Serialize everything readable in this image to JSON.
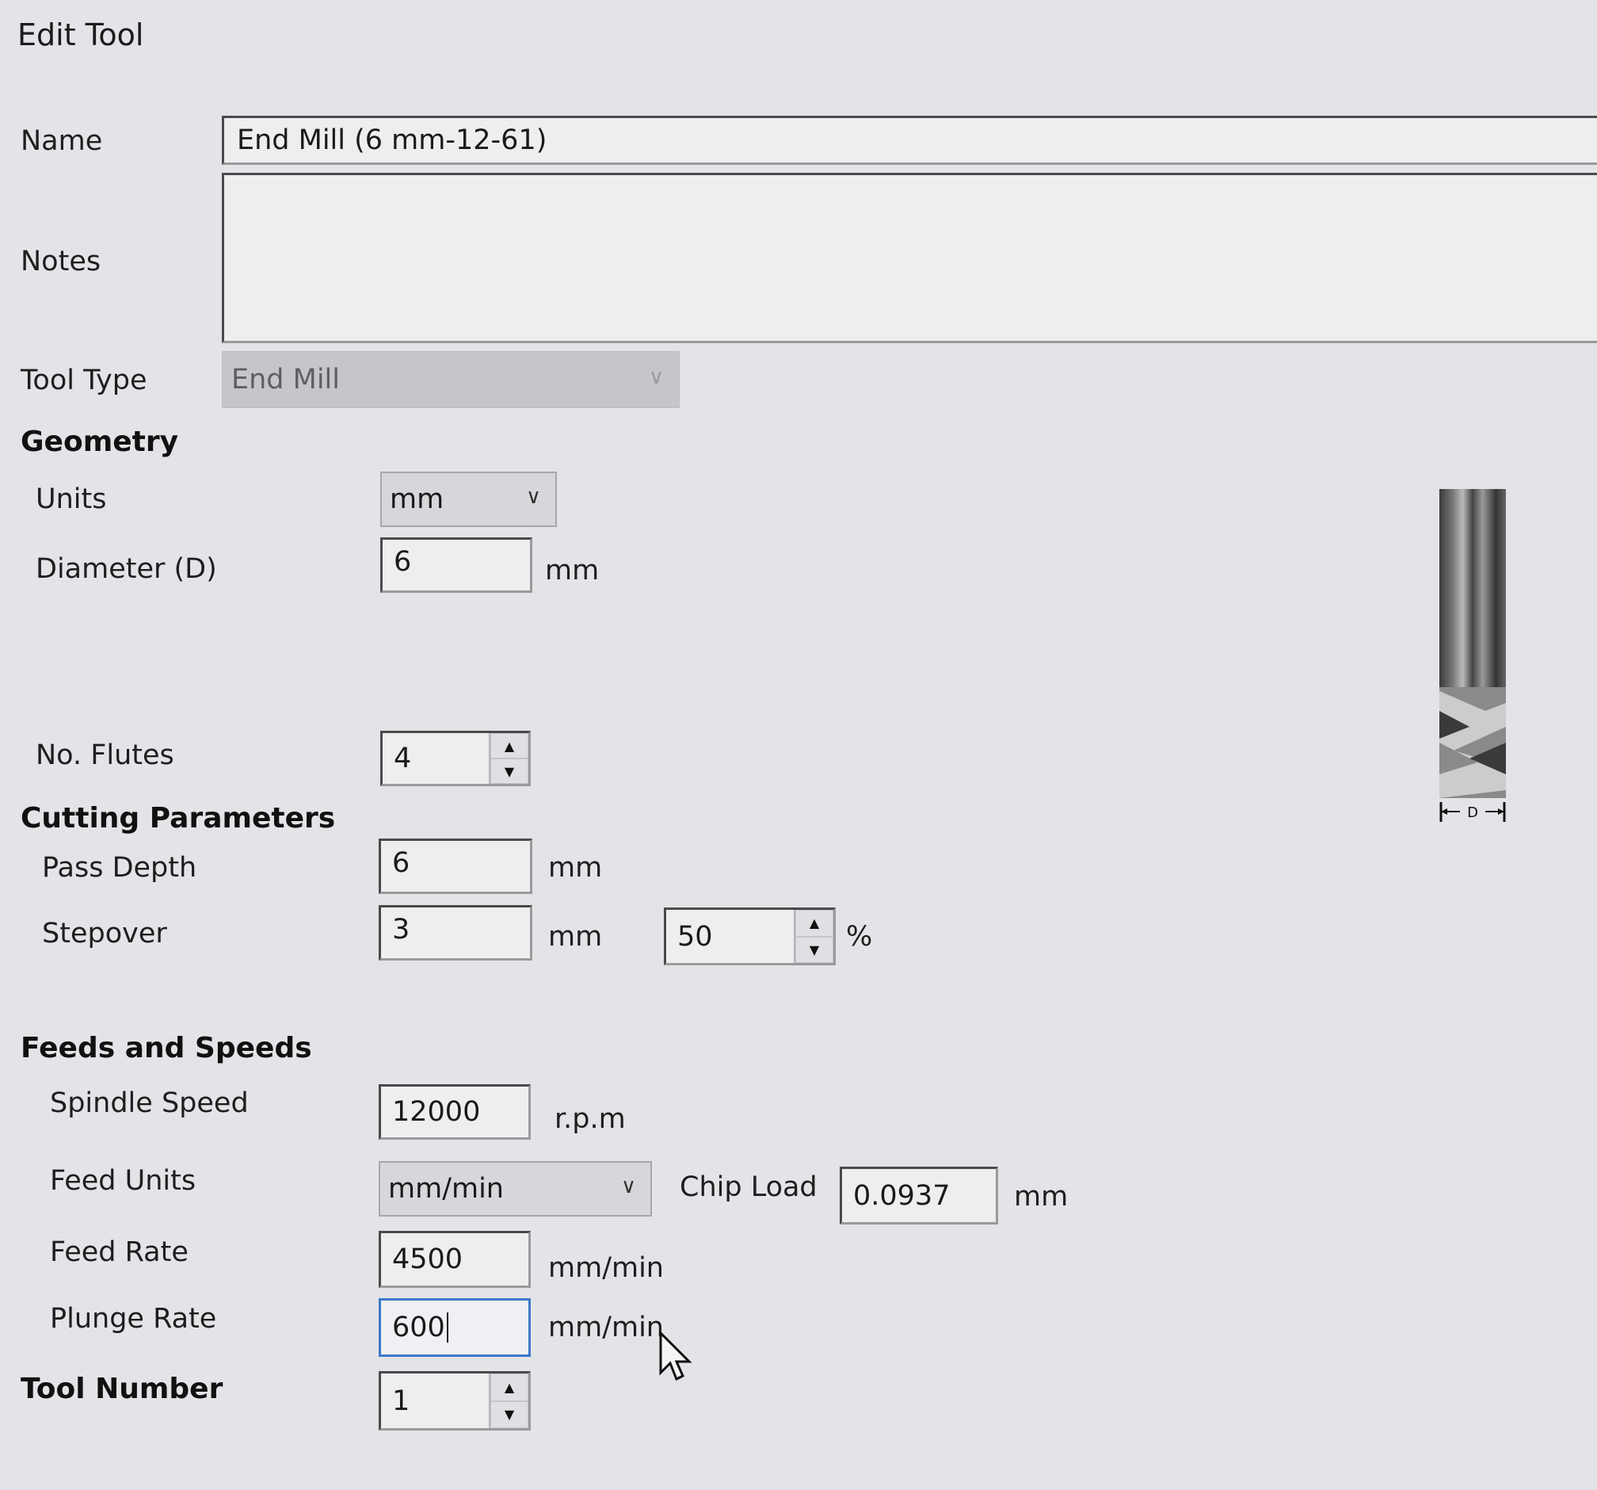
{
  "window": {
    "title": "Edit Tool"
  },
  "general": {
    "name_label": "Name",
    "name_value": "End Mill (6 mm-12-61)",
    "notes_label": "Notes",
    "notes_value": "",
    "tool_type_label": "Tool Type",
    "tool_type_value": "End Mill"
  },
  "geometry": {
    "heading": "Geometry",
    "units_label": "Units",
    "units_value": "mm",
    "diameter_label": "Diameter (D)",
    "diameter_value": "6",
    "diameter_unit": "mm",
    "flutes_label": "No. Flutes",
    "flutes_value": "4",
    "diagram_dimension_label": "D"
  },
  "cutting": {
    "heading": "Cutting Parameters",
    "pass_depth_label": "Pass Depth",
    "pass_depth_value": "6",
    "pass_depth_unit": "mm",
    "stepover_label": "Stepover",
    "stepover_value": "3",
    "stepover_unit": "mm",
    "stepover_percent_value": "50",
    "stepover_percent_unit": "%"
  },
  "feeds": {
    "heading": "Feeds and Speeds",
    "spindle_label": "Spindle Speed",
    "spindle_value": "12000",
    "spindle_unit": "r.p.m",
    "feed_units_label": "Feed Units",
    "feed_units_value": "mm/min",
    "chip_load_label": "Chip Load",
    "chip_load_value": "0.0937",
    "chip_load_unit": "mm",
    "feed_rate_label": "Feed Rate",
    "feed_rate_value": "4500",
    "feed_rate_unit": "mm/min",
    "plunge_rate_label": "Plunge Rate",
    "plunge_rate_value": "600",
    "plunge_rate_unit": "mm/min"
  },
  "tool_number": {
    "label": "Tool Number",
    "value": "1"
  },
  "icons": {
    "spin_up": "▲",
    "spin_down": "▼",
    "chevron": "∨"
  },
  "colors": {
    "focus_border": "#3b79c9",
    "background": "#e3e4e7"
  }
}
